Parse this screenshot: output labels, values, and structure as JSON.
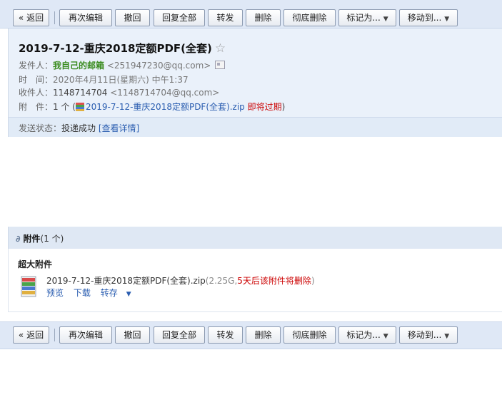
{
  "toolbar": {
    "back": "« 返回",
    "edit_again": "再次编辑",
    "withdraw": "撤回",
    "reply_all": "回复全部",
    "forward": "转发",
    "delete": "删除",
    "delete_permanently": "彻底删除",
    "mark_as": "标记为...",
    "move_to": "移动到..."
  },
  "mail": {
    "subject": "2019-7-12-重庆2018定额PDF(全套)",
    "star": "☆",
    "from_label": "发件人：",
    "from_name": "我自己的邮箱",
    "from_email": "<251947230@qq.com>",
    "time_label": "时　间：",
    "time_value": "2020年4月11日(星期六) 中午1:37",
    "to_label": "收件人：",
    "to_name": "1148714704",
    "to_email": "<1148714704@qq.com>",
    "attach_label": "附　件：",
    "attach_count": "1 个",
    "attach_open": "(",
    "attach_name": "2019-7-12-重庆2018定额PDF(全套).zip",
    "attach_expiry": "即将过期",
    "attach_close": ")",
    "status_label": "发送状态：",
    "status_value": "投递成功",
    "status_link": "[查看详情]"
  },
  "attachments": {
    "title": "附件",
    "count": "(1 个)",
    "large_title": "超大附件",
    "file_name": "2019-7-12-重庆2018定额PDF(全套).zip",
    "file_size": "(2.25G,",
    "file_warning": "5天后该附件将删除",
    "file_close": ")",
    "preview": "预览",
    "download": "下载",
    "save_to": "转存"
  }
}
